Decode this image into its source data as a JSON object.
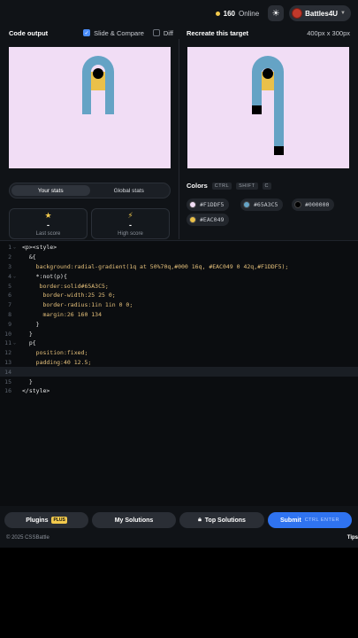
{
  "header": {
    "online_count": "160",
    "online_label": "Online",
    "user_name": "Battles4U"
  },
  "left_panel": {
    "title": "Code output",
    "slide_compare": "Slide & Compare",
    "diff": "Diff"
  },
  "right_panel": {
    "title": "Recreate this target",
    "size": "400px x 300px"
  },
  "stats": {
    "tabs": [
      "Your stats",
      "Global stats"
    ],
    "last_score_value": "-",
    "last_score_label": "Last score",
    "high_score_value": "-",
    "high_score_label": "High score"
  },
  "colors": {
    "title": "Colors",
    "shortcut": [
      "CTRL",
      "SHIFT",
      "C"
    ],
    "swatches": [
      {
        "hex": "#F1DDF5"
      },
      {
        "hex": "#65A3C5"
      },
      {
        "hex": "#000000"
      },
      {
        "hex": "#EAC049"
      }
    ]
  },
  "editor": {
    "lines": [
      {
        "n": "1",
        "fold": true,
        "text": "<p><style>"
      },
      {
        "n": "2",
        "fold": false,
        "text": "  &{"
      },
      {
        "n": "3",
        "fold": false,
        "text": "    background:radial-gradient(1q at 50%70q,#000 16q, #EAC049 0 42q,#F1DDF5);"
      },
      {
        "n": "4",
        "fold": true,
        "text": "    *:not(p){"
      },
      {
        "n": "5",
        "fold": false,
        "text": "     border:solid#65A3C5;"
      },
      {
        "n": "6",
        "fold": false,
        "text": "      border-width:25 25 0;"
      },
      {
        "n": "7",
        "fold": false,
        "text": "      border-radius:1in 1in 0 0;"
      },
      {
        "n": "8",
        "fold": false,
        "text": "      margin:26 160 134"
      },
      {
        "n": "9",
        "fold": false,
        "text": "    }"
      },
      {
        "n": "10",
        "fold": false,
        "text": "  }"
      },
      {
        "n": "11",
        "fold": true,
        "text": "  p{"
      },
      {
        "n": "12",
        "fold": false,
        "text": "    position:fixed;"
      },
      {
        "n": "13",
        "fold": false,
        "text": "    padding:40 12.5;"
      },
      {
        "n": "14",
        "fold": false,
        "text": ""
      },
      {
        "n": "15",
        "fold": false,
        "text": "  }"
      },
      {
        "n": "16",
        "fold": false,
        "text": "</style>"
      }
    ]
  },
  "bottom": {
    "plugins": "Plugins",
    "plugins_badge": "PLUS",
    "my_solutions": "My Solutions",
    "top_solutions": "Top Solutions",
    "submit": "Submit",
    "submit_kbd": "CTRL  ENTER"
  },
  "footer": {
    "copyright": "© 2025 CSSBattle",
    "tips": "Tips"
  },
  "palette": {
    "bg": "#F1DDF5",
    "blue": "#65A3C5",
    "black": "#000000",
    "yellow": "#EAC049"
  }
}
